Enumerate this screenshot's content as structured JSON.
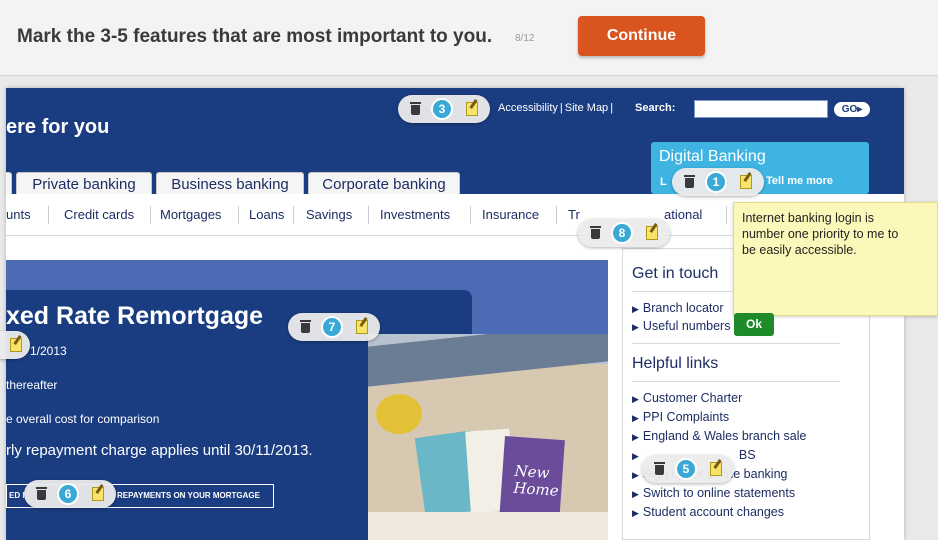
{
  "prompt": {
    "text": "Mark the 3-5 features that are most important to you.",
    "counter": "8/12",
    "continue_label": "Continue"
  },
  "site": {
    "tagline": "ere for you",
    "util_links": [
      "Accessibility",
      "Site Map"
    ],
    "search_label": "Search:",
    "search_value": "",
    "go_label": "GO▸",
    "tabs": [
      "Private banking",
      "Business banking",
      "Corporate banking"
    ],
    "digital": {
      "title": "Digital Banking",
      "first_letter": "L",
      "tell_me_more": "Tell me more"
    },
    "subnav": [
      "unts",
      "Credit cards",
      "Mortgages",
      "Loans",
      "Savings",
      "Investments",
      "Insurance",
      "Tr",
      "ational"
    ],
    "hero": {
      "title": "xed Rate Remortgage",
      "date": "1/2013",
      "line1": "thereafter",
      "line2": "e overall cost for comparison",
      "line3": "rly repayment charge applies until 30/11/2013.",
      "cta_left": "ED I",
      "cta_right": "REPAYMENTS ON YOUR MORTGAGE"
    },
    "photo_card_text": "New Home",
    "get_in_touch": {
      "heading": "Get in touch",
      "items": [
        "Branch locator",
        "Useful numbers"
      ]
    },
    "helpful_links": {
      "heading": "Helpful links",
      "items": [
        "Customer Charter",
        "PPI Complaints",
        "England & Wales branch sale",
        "BS",
        "Sign up for online banking",
        "Switch to online statements",
        "Student account changes"
      ]
    }
  },
  "note": {
    "text_lines": [
      "Internet banking login is",
      "number one priority to me to",
      "be easily accessible."
    ],
    "ok_label": "Ok"
  },
  "markers": [
    {
      "num": "3"
    },
    {
      "num": "1"
    },
    {
      "num": "8"
    },
    {
      "num": "7"
    },
    {
      "num": "6"
    },
    {
      "num": "5"
    }
  ],
  "colors": {
    "continue": "#d9541e",
    "header": "#1a3c81",
    "digital": "#3fb4e3",
    "marker": "#3aa9d6",
    "note": "#fcf8b9",
    "ok": "#1f8a2a"
  }
}
